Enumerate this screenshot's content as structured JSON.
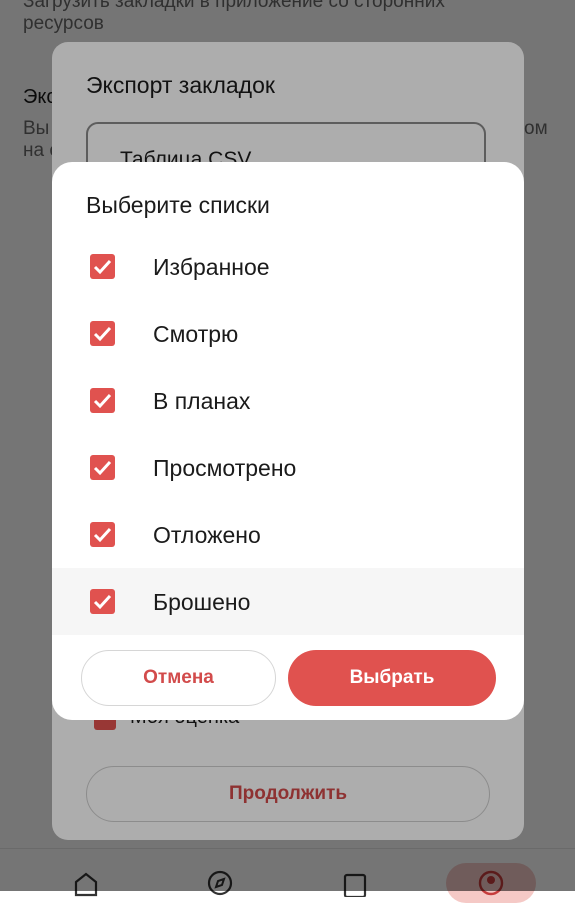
{
  "background_page": {
    "import_desc_line1": "Загрузить закладки в приложение со сторонних",
    "import_desc_line2": "ресурсов",
    "export_title_partial": "Экс",
    "export_desc_partial_1": "Вы",
    "export_desc_partial_2": "на с",
    "export_desc_right": "ом"
  },
  "bottom_nav": {
    "items": [
      "home-icon",
      "compass-icon",
      "bookmark-icon",
      "profile-icon"
    ],
    "active": "profile-icon"
  },
  "export_sheet": {
    "title": "Экспорт закладок",
    "format_value": "Таблица CSV",
    "rating_label": "Моя оценка",
    "continue_label": "Продолжить"
  },
  "dialog": {
    "title": "Выберите списки",
    "options": [
      {
        "label": "Избранное",
        "checked": true
      },
      {
        "label": "Смотрю",
        "checked": true
      },
      {
        "label": "В планах",
        "checked": true
      },
      {
        "label": "Просмотрено",
        "checked": true
      },
      {
        "label": "Отложено",
        "checked": true
      },
      {
        "label": "Брошено",
        "checked": true
      }
    ],
    "cancel_label": "Отмена",
    "confirm_label": "Выбрать"
  },
  "colors": {
    "accent": "#e0524f",
    "accent_text": "#d24b4b"
  }
}
